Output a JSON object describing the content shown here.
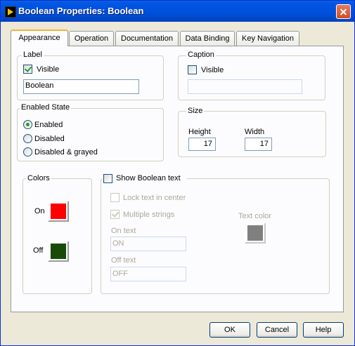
{
  "window": {
    "title": "Boolean Properties: Boolean"
  },
  "tabs": [
    {
      "label": "Appearance",
      "active": true
    },
    {
      "label": "Operation"
    },
    {
      "label": "Documentation"
    },
    {
      "label": "Data Binding"
    },
    {
      "label": "Key Navigation"
    }
  ],
  "label_group": {
    "title": "Label",
    "visible_label": "Visible",
    "visible_checked": true,
    "value": "Boolean"
  },
  "caption_group": {
    "title": "Caption",
    "visible_label": "Visible",
    "visible_checked": false,
    "value": ""
  },
  "enabled_state": {
    "title": "Enabled State",
    "options": [
      "Enabled",
      "Disabled",
      "Disabled & grayed"
    ],
    "selected": "Enabled"
  },
  "size": {
    "title": "Size",
    "height_label": "Height",
    "height_value": "17",
    "width_label": "Width",
    "width_value": "17"
  },
  "colors": {
    "title": "Colors",
    "on_label": "On",
    "on_color": "#ff0000",
    "off_label": "Off",
    "off_color": "#1a4a0a"
  },
  "boolean_text": {
    "show_label": "Show Boolean text",
    "show_checked": false,
    "lock_label": "Lock text in center",
    "lock_checked": false,
    "multiple_label": "Multiple strings",
    "multiple_checked": true,
    "on_text_label": "On text",
    "on_text_value": "ON",
    "off_text_label": "Off text",
    "off_text_value": "OFF",
    "text_color_label": "Text color",
    "text_color": "#808080"
  },
  "buttons": {
    "ok": "OK",
    "cancel": "Cancel",
    "help": "Help"
  }
}
